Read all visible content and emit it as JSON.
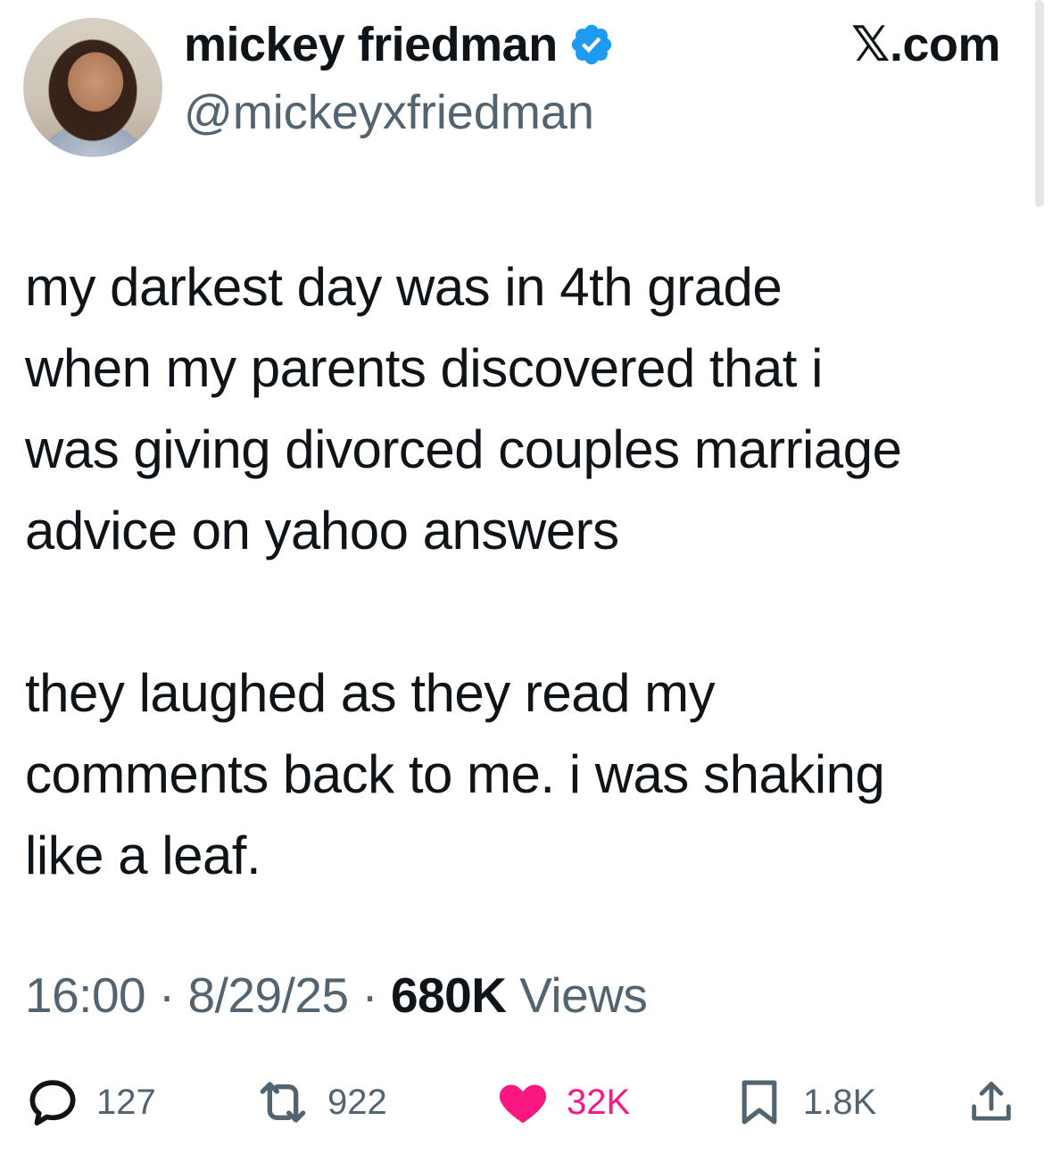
{
  "author": {
    "display_name": "mickey friedman",
    "handle": "@mickeyxfriedman",
    "verified": true
  },
  "site": "𝕏.com",
  "tweet": {
    "paragraph_1": "my darkest day was in 4th grade\nwhen my parents discovered that i\nwas giving divorced couples marriage\nadvice on yahoo answers",
    "paragraph_2": "they laughed as they read my\ncomments back to me. i was shaking\nlike a leaf."
  },
  "meta": {
    "time": "16:00",
    "separator": "·",
    "date": "8/29/25",
    "views_count": "680K",
    "views_label": "Views"
  },
  "actions": {
    "replies": "127",
    "reposts": "922",
    "likes": "32K",
    "bookmarks": "1.8K"
  },
  "colors": {
    "verified_blue": "#1d9bf0",
    "like_pink": "#f91880",
    "muted": "#536471",
    "text": "#0f1419"
  },
  "icons": [
    "verified-badge-icon",
    "reply-icon",
    "repost-icon",
    "like-icon",
    "bookmark-icon",
    "share-icon"
  ]
}
